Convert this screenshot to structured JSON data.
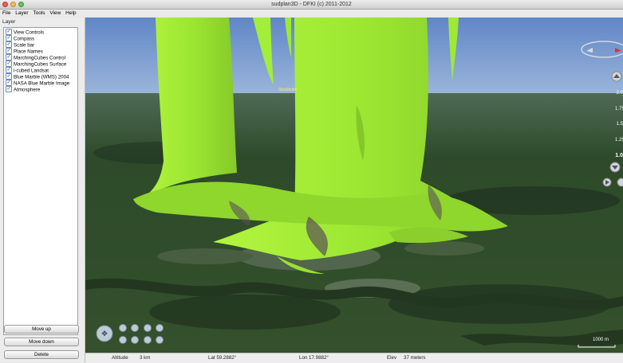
{
  "window": {
    "title": "sudplan3D - DFKI (c) 2011-2012"
  },
  "menu": [
    "File",
    "Layer",
    "Tools",
    "View",
    "Help"
  ],
  "sidebar": {
    "title": "Layer",
    "layers": [
      {
        "label": "View Controls",
        "checked": true
      },
      {
        "label": "Compass",
        "checked": true
      },
      {
        "label": "Scale bar",
        "checked": true
      },
      {
        "label": "Place Names",
        "checked": true
      },
      {
        "label": "MarchingCubes Control",
        "checked": true
      },
      {
        "label": "MarchingCubes Surface",
        "checked": true
      },
      {
        "label": "i-cubed Landsat",
        "checked": true
      },
      {
        "label": "Blue Marble (WMS) 2004",
        "checked": true
      },
      {
        "label": "NASA Blue Marble Image",
        "checked": true
      },
      {
        "label": "Atmosphere",
        "checked": true
      }
    ],
    "buttons": {
      "move_up": "Move up",
      "move_down": "Move down",
      "delete": "Delete"
    }
  },
  "globe": {
    "place_label": "Stockholm",
    "scale_bar": "1000 m",
    "exaggeration_values": [
      "2.0",
      "1.75",
      "1.5",
      "1.25",
      "1.0"
    ],
    "colors": {
      "surface": "#a4f234",
      "sky": "#6c8fc4",
      "terrain": "#2f4a28"
    }
  },
  "status": {
    "altitude_label": "Altitude",
    "altitude_value": "3 km",
    "lat": "Lat 59.2882°",
    "lon": "Lon 17.9882°",
    "elev_label": "Elev",
    "elev_value": "37 meters"
  }
}
